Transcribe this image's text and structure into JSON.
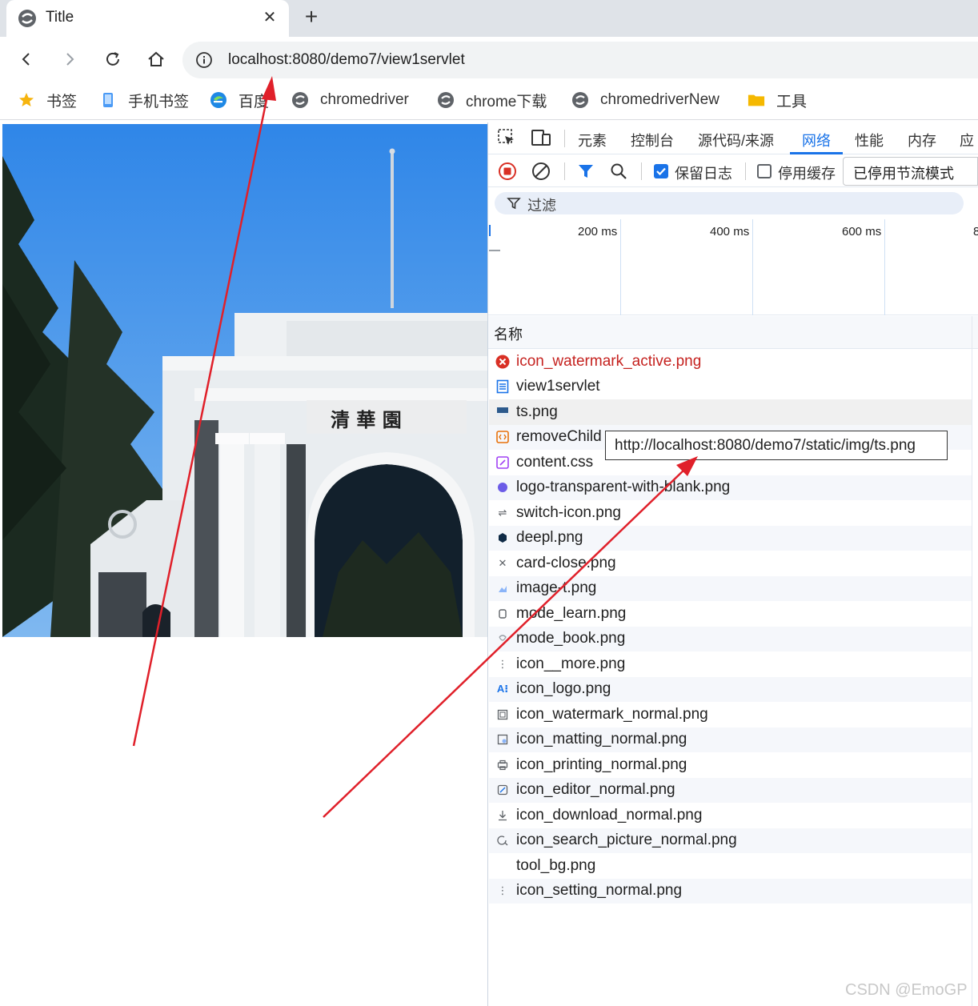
{
  "tab": {
    "title": "Title",
    "close_glyph": "✕",
    "new_tab_glyph": "+"
  },
  "toolbar": {
    "url": "localhost:8080/demo7/view1servlet"
  },
  "bookmarks": [
    {
      "label": "书签",
      "icon": "star-icon"
    },
    {
      "label": "手机书签",
      "icon": "phone-icon"
    },
    {
      "label": "百度",
      "icon": "edge-logo-icon"
    },
    {
      "label": "chromedriver",
      "icon": "site-icon"
    },
    {
      "label": "chrome下载",
      "icon": "site-icon"
    },
    {
      "label": "chromedriverNew",
      "icon": "site-icon"
    },
    {
      "label": "工具",
      "icon": "folder-icon"
    }
  ],
  "devtools": {
    "tabs": [
      "元素",
      "控制台",
      "源代码/来源",
      "网络",
      "性能",
      "内存",
      "应"
    ],
    "active_tab": "网络",
    "preserve_log": {
      "label": "保留日志",
      "checked": true
    },
    "disable_cache": {
      "label": "停用缓存",
      "checked": false
    },
    "throttle": "已停用节流模式",
    "filter_placeholder": "过滤",
    "ticks": [
      "200 ms",
      "400 ms",
      "600 ms",
      "8"
    ],
    "name_header": "名称",
    "requests": [
      {
        "name": "icon_watermark_active.png",
        "icon": "error-icon",
        "error": true
      },
      {
        "name": "view1servlet",
        "icon": "document-icon"
      },
      {
        "name": "ts.png",
        "icon": "image-icon"
      },
      {
        "name": "removeChild",
        "icon": "script-icon"
      },
      {
        "name": "content.css",
        "icon": "stylesheet-icon"
      },
      {
        "name": "logo-transparent-with-blank.png",
        "icon": "logo-icon"
      },
      {
        "name": "switch-icon.png",
        "icon": "switch-icon"
      },
      {
        "name": "deepl.png",
        "icon": "deepl-icon"
      },
      {
        "name": "card-close.png",
        "icon": "close-icon"
      },
      {
        "name": "image-t.png",
        "icon": "image-icon"
      },
      {
        "name": "mode_learn.png",
        "icon": "learn-icon"
      },
      {
        "name": "mode_book.png",
        "icon": "book-icon"
      },
      {
        "name": "icon__more.png",
        "icon": "more-icon"
      },
      {
        "name": "icon_logo.png",
        "icon": "ai-icon"
      },
      {
        "name": "icon_watermark_normal.png",
        "icon": "watermark-icon"
      },
      {
        "name": "icon_matting_normal.png",
        "icon": "matting-icon"
      },
      {
        "name": "icon_printing_normal.png",
        "icon": "printer-icon"
      },
      {
        "name": "icon_editor_normal.png",
        "icon": "editor-icon"
      },
      {
        "name": "icon_download_normal.png",
        "icon": "download-icon"
      },
      {
        "name": "icon_search_picture_normal.png",
        "icon": "search-picture-icon"
      },
      {
        "name": "tool_bg.png",
        "icon": "blank-icon"
      },
      {
        "name": "icon_setting_normal.png",
        "icon": "more-icon"
      }
    ],
    "tooltip": "http://localhost:8080/demo7/static/img/ts.png"
  },
  "page_image": {
    "caption_chars": "清 華 園"
  },
  "watermark": "CSDN @EmoGP",
  "colors": {
    "accent": "#1a73e8",
    "error": "#c5221f",
    "arrow": "#e0202a"
  }
}
